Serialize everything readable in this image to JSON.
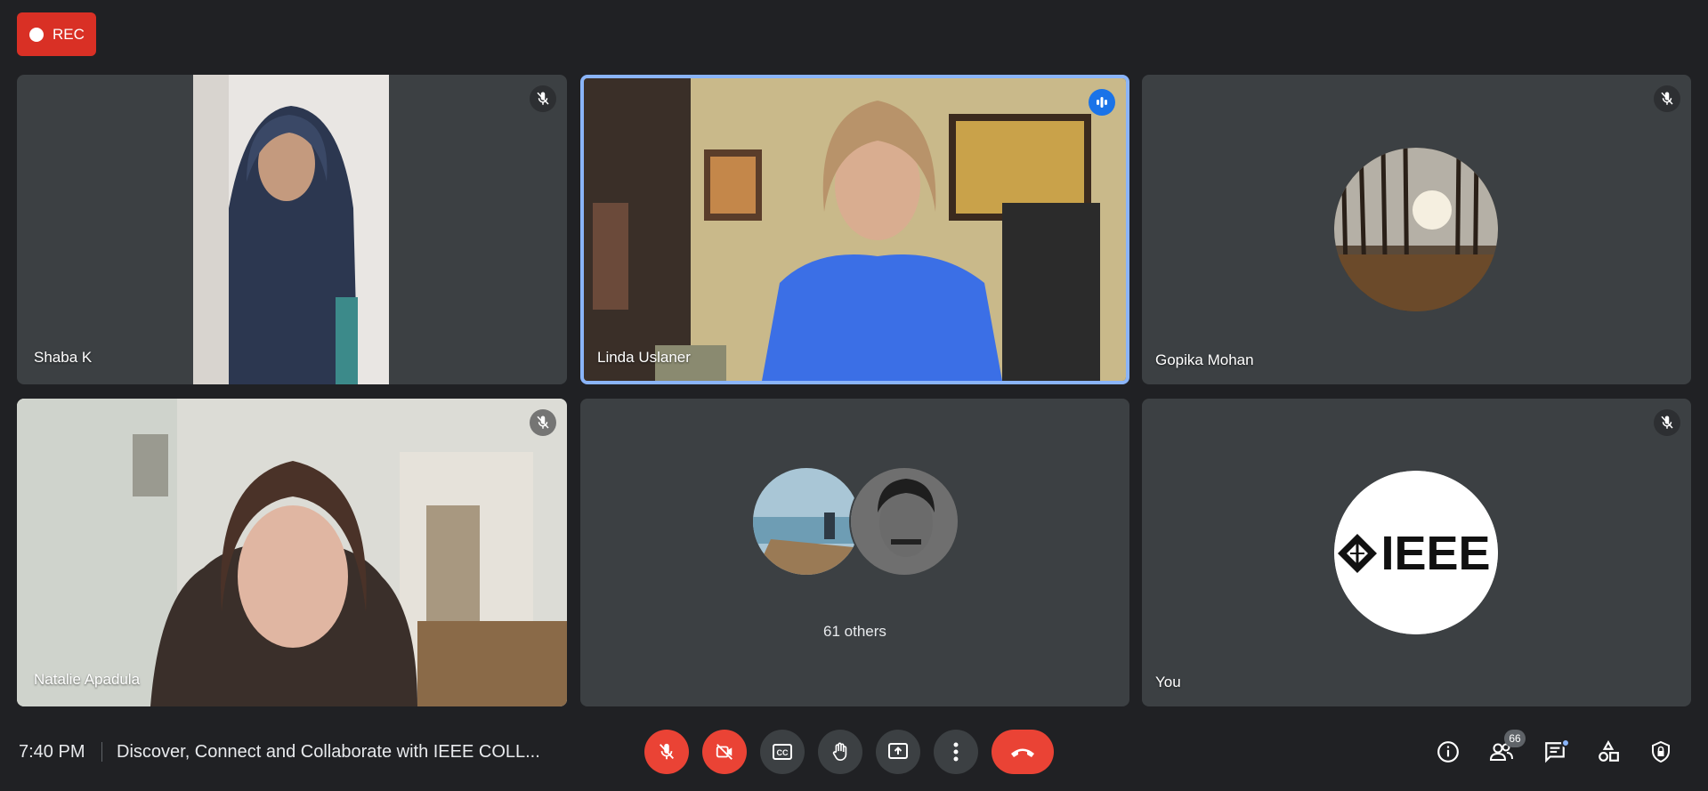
{
  "recording": {
    "label": "REC"
  },
  "participants": [
    {
      "name": "Shaba K",
      "muted": true
    },
    {
      "name": "Linda Uslaner",
      "speaking": true
    },
    {
      "name": "Gopika Mohan",
      "muted": true
    },
    {
      "name": "Natalie Apadula",
      "muted": true
    },
    {
      "name": "You",
      "muted": true
    }
  ],
  "others": {
    "label": "61 others"
  },
  "bottom_bar": {
    "time": "7:40 PM",
    "meeting_title": "Discover, Connect and Collaborate with IEEE COLL...",
    "people_count": "66"
  },
  "self_avatar": {
    "logo_text": "IEEE"
  },
  "colors": {
    "background": "#202124",
    "tile": "#3c4043",
    "danger": "#ea4335",
    "active_border": "#8ab4f8",
    "accent": "#1a73e8"
  },
  "icons": {
    "controls": [
      "mic-off-icon",
      "camera-off-icon",
      "captions-icon",
      "raise-hand-icon",
      "present-icon",
      "more-options-icon",
      "hang-up-icon"
    ],
    "right": [
      "info-icon",
      "people-icon",
      "chat-icon",
      "activities-icon",
      "host-controls-icon"
    ]
  }
}
